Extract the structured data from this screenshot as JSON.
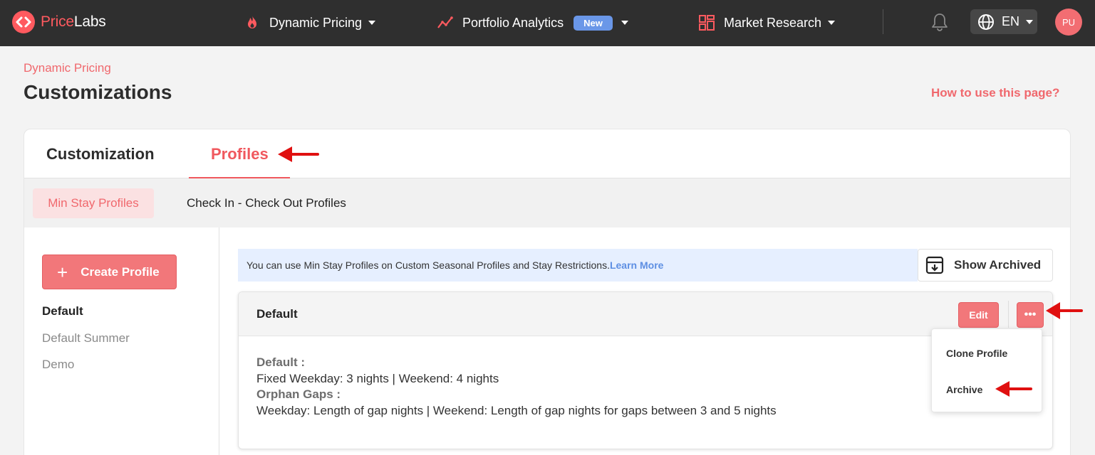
{
  "brand": {
    "name_part1": "Price",
    "name_part2": "Labs",
    "accent": "#ff5a5f"
  },
  "nav": {
    "items": [
      {
        "label": "Dynamic Pricing",
        "icon": "flame-icon"
      },
      {
        "label": "Portfolio Analytics",
        "icon": "trend-chart-icon",
        "badge": "New"
      },
      {
        "label": "Market Research",
        "icon": "grid-dashboard-icon"
      }
    ],
    "bell_icon": "bell-icon",
    "language": "EN",
    "avatar_initials": "PU"
  },
  "header": {
    "breadcrumb": "Dynamic Pricing",
    "title": "Customizations",
    "help_link": "How to use this page?"
  },
  "tabs": [
    {
      "label": "Customization",
      "active": false
    },
    {
      "label": "Profiles",
      "active": true
    }
  ],
  "subtabs": [
    {
      "label": "Min Stay Profiles",
      "active": true
    },
    {
      "label": "Check In - Check Out Profiles",
      "active": false
    }
  ],
  "sidebar": {
    "create_button": "Create Profile",
    "profiles": [
      "Default",
      "Default Summer",
      "Demo"
    ]
  },
  "banner": {
    "text": "You can use Min Stay Profiles on Custom Seasonal Profiles and Stay Restrictions.",
    "link": "Learn More"
  },
  "show_archived_label": "Show Archived",
  "profile_card": {
    "title": "Default",
    "edit_label": "Edit",
    "more_label": "•••",
    "body": {
      "label1": "Default :",
      "line1": "Fixed Weekday: 3 nights | Weekend: 4 nights",
      "label2": "Orphan Gaps :",
      "line2": "Weekday: Length of gap nights | Weekend: Length of gap nights for gaps between 3 and 5 nights"
    }
  },
  "menu": {
    "items": [
      "Clone Profile",
      "Archive"
    ]
  },
  "colors": {
    "topbar": "#2f2f2f",
    "primary": "#f2777a",
    "link_blue": "#5e8fe3",
    "annotation_arrow": "#e01010"
  }
}
